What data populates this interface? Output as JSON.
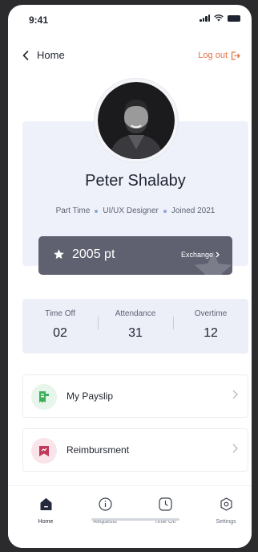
{
  "status_bar": {
    "time": "9:41"
  },
  "header": {
    "back_title": "Home",
    "logout_label": "Log out"
  },
  "profile": {
    "name": "Peter Shalaby",
    "employment_type": "Part Time",
    "role": "UI/UX Designer",
    "joined": "Joined 2021"
  },
  "points": {
    "value": "2005 pt",
    "exchange_label": "Exchange"
  },
  "stats": [
    {
      "label": "Time Off",
      "value": "02"
    },
    {
      "label": "Attendance",
      "value": "31"
    },
    {
      "label": "Overtime",
      "value": "12"
    }
  ],
  "menu": [
    {
      "label": "My Payslip",
      "icon": "receipt-icon",
      "color": "#3fae5a",
      "bg": "#e7f5ea"
    },
    {
      "label": "Reimbursment",
      "icon": "bookmark-icon",
      "color": "#c0385a",
      "bg": "#f9e4ea"
    }
  ],
  "nav": [
    {
      "label": "Home",
      "icon": "home-icon",
      "active": true
    },
    {
      "label": "Requests",
      "icon": "info-icon",
      "active": false
    },
    {
      "label": "Time Off",
      "icon": "clock-icon",
      "active": false
    },
    {
      "label": "Settings",
      "icon": "settings-icon",
      "active": false
    }
  ],
  "colors": {
    "accent": "#e3734a",
    "points_card": "#5f6171",
    "card_bg": "#eef1f9"
  }
}
